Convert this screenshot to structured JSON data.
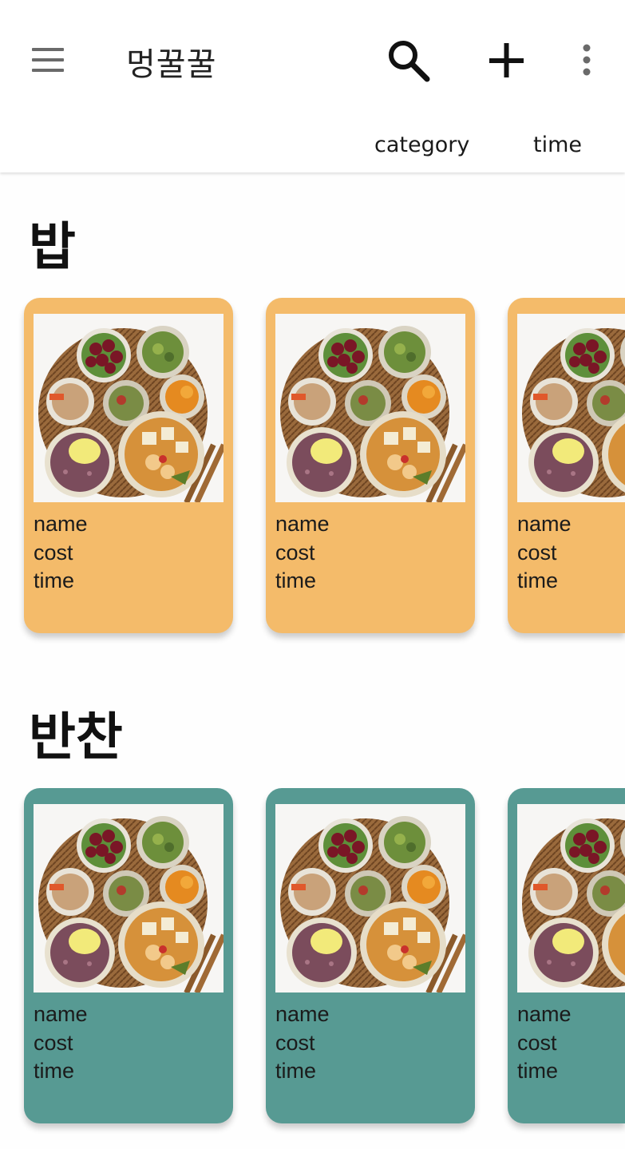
{
  "app": {
    "title": "멍꿀꿀"
  },
  "toolbar": {
    "menu_icon": "hamburger-menu-icon",
    "search_icon": "search-icon",
    "add_icon": "plus-icon",
    "more_icon": "more-vert-icon"
  },
  "filters": [
    {
      "label": "category"
    },
    {
      "label": "time"
    }
  ],
  "colors": {
    "rice_card": "#f4bb6a",
    "side_card": "#579a93",
    "background": "#fefefe"
  },
  "sections": [
    {
      "title": "밥",
      "cards": [
        {
          "name": "name",
          "cost": "cost",
          "time": "time"
        },
        {
          "name": "name",
          "cost": "cost",
          "time": "time"
        },
        {
          "name": "name",
          "cost": "cost",
          "time": "time"
        }
      ]
    },
    {
      "title": "반찬",
      "cards": [
        {
          "name": "name",
          "cost": "cost",
          "time": "time"
        },
        {
          "name": "name",
          "cost": "cost",
          "time": "time"
        },
        {
          "name": "name",
          "cost": "cost",
          "time": "time"
        }
      ]
    }
  ]
}
